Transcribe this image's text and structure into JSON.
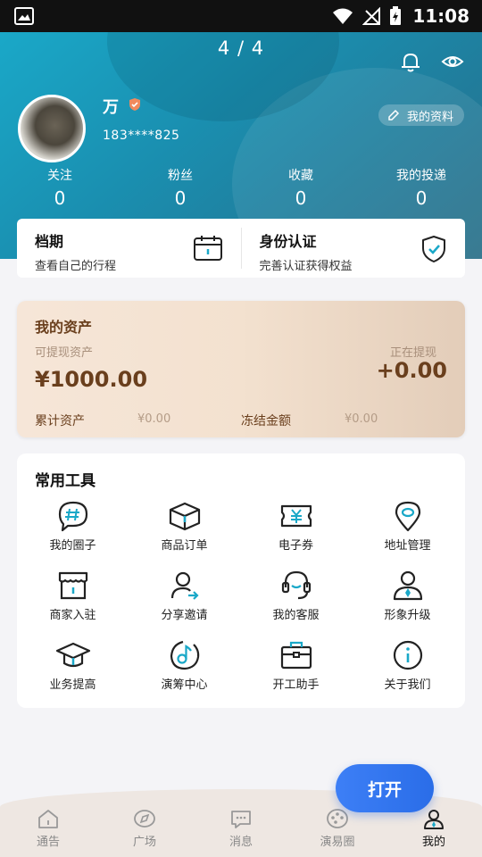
{
  "status_bar": {
    "time": "11:08"
  },
  "header": {
    "page_indicator": "4 / 4",
    "user": {
      "name": "万",
      "phone": "183****825"
    },
    "profile_button_label": "我的资料",
    "stats": [
      {
        "label": "关注",
        "value": "0"
      },
      {
        "label": "粉丝",
        "value": "0"
      },
      {
        "label": "收藏",
        "value": "0"
      },
      {
        "label": "我的投递",
        "value": "0"
      }
    ]
  },
  "cards": {
    "schedule": {
      "title": "档期",
      "subtitle": "查看自己的行程"
    },
    "identity": {
      "title": "身份认证",
      "subtitle": "完善认证获得权益"
    }
  },
  "assets": {
    "title": "我的资产",
    "withdrawable_label": "可提现资产",
    "withdrawable_amount": "¥1000.00",
    "withdrawing_label": "正在提现",
    "withdrawing_amount": "+0.00",
    "accumulated_label": "累计资产",
    "accumulated_value": "¥0.00",
    "frozen_label": "冻结金额",
    "frozen_value": "¥0.00"
  },
  "tools": {
    "title": "常用工具",
    "items": [
      {
        "label": "我的圈子",
        "icon": "circle-hash-icon"
      },
      {
        "label": "商品订单",
        "icon": "box-icon"
      },
      {
        "label": "电子券",
        "icon": "ticket-icon"
      },
      {
        "label": "地址管理",
        "icon": "location-icon"
      },
      {
        "label": "商家入驻",
        "icon": "store-icon"
      },
      {
        "label": "分享邀请",
        "icon": "share-user-icon"
      },
      {
        "label": "我的客服",
        "icon": "headset-icon"
      },
      {
        "label": "形象升级",
        "icon": "user-tie-icon"
      },
      {
        "label": "业务提高",
        "icon": "graduation-cap-icon"
      },
      {
        "label": "演筹中心",
        "icon": "music-note-icon"
      },
      {
        "label": "开工助手",
        "icon": "briefcase-icon"
      },
      {
        "label": "关于我们",
        "icon": "info-icon"
      }
    ]
  },
  "open_button_label": "打开",
  "nav": {
    "items": [
      {
        "label": "通告",
        "icon": "home-icon"
      },
      {
        "label": "广场",
        "icon": "compass-icon"
      },
      {
        "label": "消息",
        "icon": "message-icon"
      },
      {
        "label": "演易圈",
        "icon": "palette-icon"
      },
      {
        "label": "我的",
        "icon": "profile-icon"
      }
    ],
    "active_index": 4
  },
  "colors": {
    "accent_teal": "#1aa8c8",
    "asset_brown": "#6a3f1d",
    "open_button": "#3d7ff6",
    "icon_dark": "#222222"
  }
}
